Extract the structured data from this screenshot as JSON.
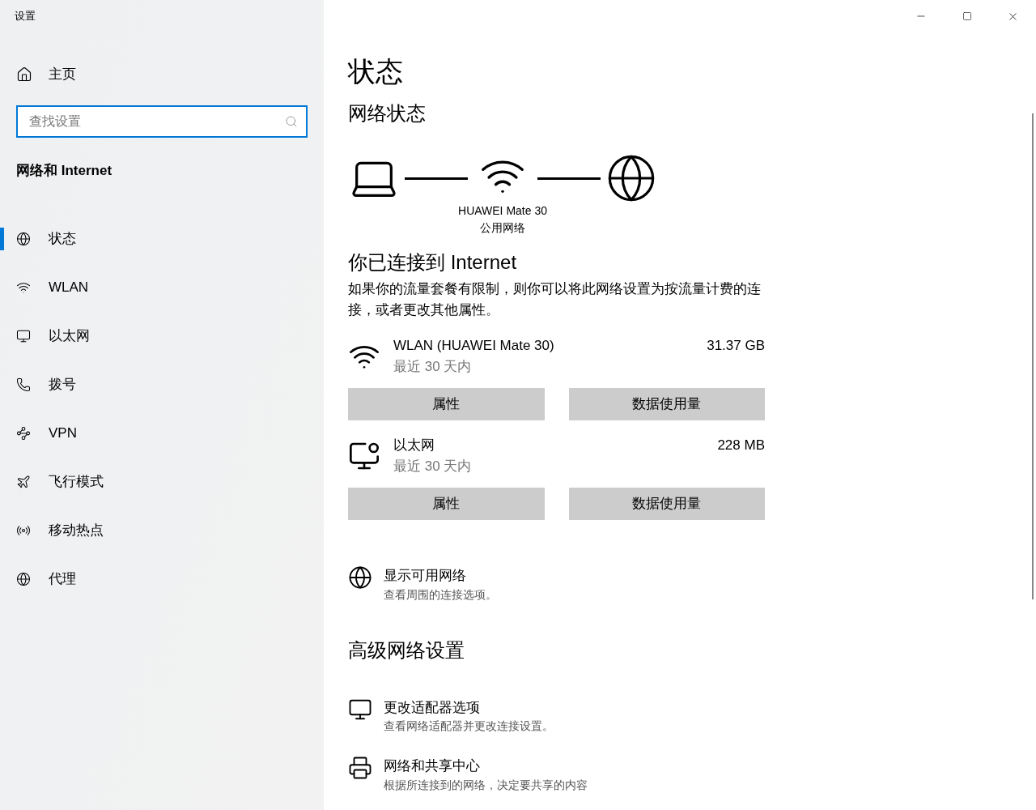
{
  "window": {
    "title": "设置"
  },
  "sidebar": {
    "home": "主页",
    "search": {
      "placeholder": "查找设置"
    },
    "section": "网络和 Internet",
    "items": [
      {
        "label": "状态",
        "kind": "status",
        "selected": true
      },
      {
        "label": "WLAN",
        "kind": "wifi",
        "selected": false
      },
      {
        "label": "以太网",
        "kind": "ethernet",
        "selected": false
      },
      {
        "label": "拨号",
        "kind": "dialup",
        "selected": false
      },
      {
        "label": "VPN",
        "kind": "vpn",
        "selected": false
      },
      {
        "label": "飞行模式",
        "kind": "airplane",
        "selected": false
      },
      {
        "label": "移动热点",
        "kind": "hotspot",
        "selected": false
      },
      {
        "label": "代理",
        "kind": "proxy",
        "selected": false
      }
    ]
  },
  "page": {
    "title": "状态",
    "network_status": "网络状态",
    "diagram": {
      "network_name": "HUAWEI Mate 30",
      "network_type": "公用网络"
    },
    "connected_title": "你已连接到 Internet",
    "connected_text": "如果你的流量套餐有限制，则你可以将此网络设置为按流量计费的连接，或者更改其他属性。",
    "connections": [
      {
        "kind": "wifi",
        "name": "WLAN (HUAWEI Mate 30)",
        "period": "最近 30 天内",
        "usage": "31.37 GB",
        "buttons": [
          "属性",
          "数据使用量"
        ]
      },
      {
        "kind": "ethernet",
        "name": "以太网",
        "period": "最近 30 天内",
        "usage": "228 MB",
        "buttons": [
          "属性",
          "数据使用量"
        ]
      }
    ],
    "show_networks": {
      "title": "显示可用网络",
      "subtitle": "查看周围的连接选项。"
    },
    "advanced_title": "高级网络设置",
    "advanced": [
      {
        "kind": "adapter",
        "title": "更改适配器选项",
        "subtitle": "查看网络适配器并更改连接设置。"
      },
      {
        "kind": "sharing",
        "title": "网络和共享中心",
        "subtitle": "根据所连接到的网络，决定要共享的内容"
      }
    ]
  }
}
